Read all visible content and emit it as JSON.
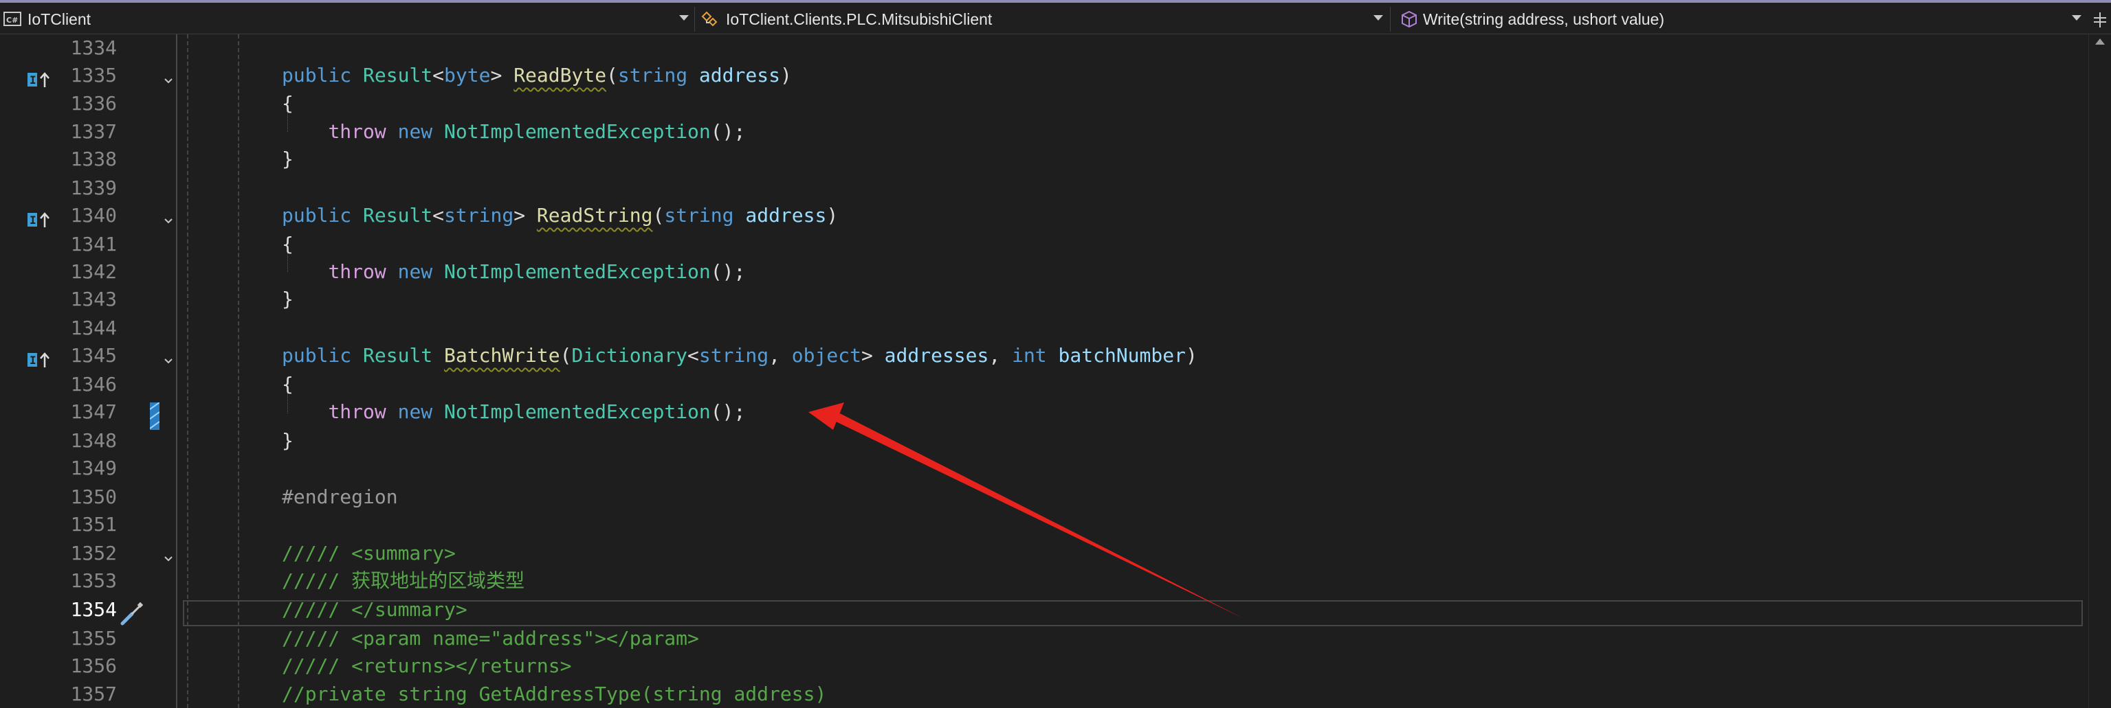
{
  "navbar": {
    "project": "IoTClient",
    "class": "IoTClient.Clients.PLC.MitsubishiClient",
    "member": "Write(string address, ushort value)"
  },
  "icons": {
    "project": "csharp-project-icon",
    "class": "class-icon",
    "member": "method-cube-icon",
    "split": "split-editor-icon",
    "implements": "implements-interface-icon",
    "quick_action": "screwdriver-icon"
  },
  "colors": {
    "accent_top": "#8f8cb8",
    "keyword": "#569cd6",
    "control": "#d8a0df",
    "type": "#4ec9b0",
    "method": "#dcdcaa",
    "param": "#9cdcfe",
    "comment": "#57a64a",
    "arrow": "#e8231e"
  },
  "editor": {
    "current_line": "1354",
    "lines": [
      {
        "num": "1334",
        "text": ""
      },
      {
        "num": "1335",
        "text": "public Result<byte> ReadByte(string address)"
      },
      {
        "num": "1336",
        "text": "{"
      },
      {
        "num": "1337",
        "text": "    throw new NotImplementedException();"
      },
      {
        "num": "1338",
        "text": "}"
      },
      {
        "num": "1339",
        "text": ""
      },
      {
        "num": "1340",
        "text": "public Result<string> ReadString(string address)"
      },
      {
        "num": "1341",
        "text": "{"
      },
      {
        "num": "1342",
        "text": "    throw new NotImplementedException();"
      },
      {
        "num": "1343",
        "text": "}"
      },
      {
        "num": "1344",
        "text": ""
      },
      {
        "num": "1345",
        "text": "public Result BatchWrite(Dictionary<string, object> addresses, int batchNumber)"
      },
      {
        "num": "1346",
        "text": "{"
      },
      {
        "num": "1347",
        "text": "    throw new NotImplementedException();"
      },
      {
        "num": "1348",
        "text": "}"
      },
      {
        "num": "1349",
        "text": ""
      },
      {
        "num": "1350",
        "text": "#endregion"
      },
      {
        "num": "1351",
        "text": ""
      },
      {
        "num": "1352",
        "text": "///// <summary>"
      },
      {
        "num": "1353",
        "text": "///// 获取地址的区域类型"
      },
      {
        "num": "1354",
        "text": "///// </summary>"
      },
      {
        "num": "1355",
        "text": "///// <param name=\"address\"></param>"
      },
      {
        "num": "1356",
        "text": "///// <returns></returns>"
      },
      {
        "num": "1357",
        "text": "//private string GetAddressType(string address)"
      }
    ]
  }
}
